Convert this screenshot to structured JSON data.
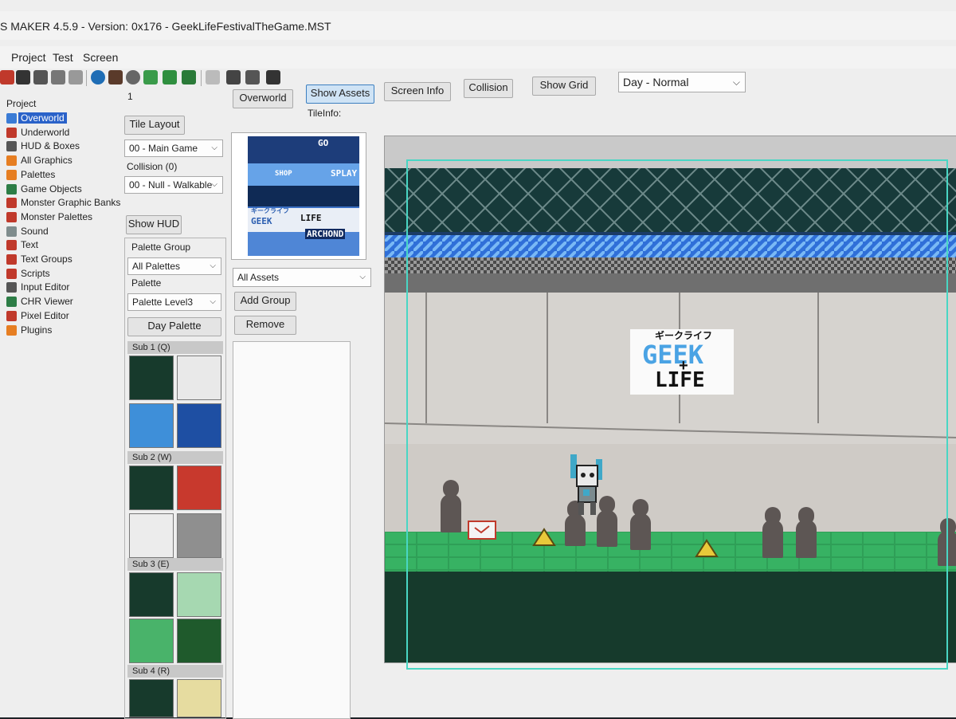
{
  "window": {
    "title": "S MAKER 4.5.9 - Version: 0x176 - GeekLifeFestivalTheGame.MST"
  },
  "menu": [
    "Project",
    "Test",
    "Screen"
  ],
  "tree": {
    "root": "Project",
    "items": [
      {
        "label": "Overworld",
        "selected": true,
        "icon_color": "#3a7bd5"
      },
      {
        "label": "Underworld",
        "icon_color": "#c0392b"
      },
      {
        "label": "HUD & Boxes",
        "icon_color": "#555555"
      },
      {
        "label": "All Graphics",
        "icon_color": "#e67e22"
      },
      {
        "label": "Palettes",
        "icon_color": "#e67e22"
      },
      {
        "label": "Game Objects",
        "icon_color": "#2d7d46"
      },
      {
        "label": "Monster Graphic Banks",
        "icon_color": "#c0392b"
      },
      {
        "label": "Monster Palettes",
        "icon_color": "#c0392b"
      },
      {
        "label": "Sound",
        "icon_color": "#7f8c8d"
      },
      {
        "label": "Text",
        "icon_color": "#c0392b"
      },
      {
        "label": "Text Groups",
        "icon_color": "#c0392b"
      },
      {
        "label": "Scripts",
        "icon_color": "#c0392b"
      },
      {
        "label": "Input Editor",
        "icon_color": "#555555"
      },
      {
        "label": "CHR Viewer",
        "icon_color": "#2d7d46"
      },
      {
        "label": "Pixel Editor",
        "icon_color": "#c0392b"
      },
      {
        "label": "Plugins",
        "icon_color": "#e67e22"
      }
    ]
  },
  "left_panel": {
    "index": "1",
    "tile_layout_button": "Tile Layout",
    "layer_select": "00 - Main Game",
    "collision_label": "Collision (0)",
    "collision_select": "00 - Null - Walkable",
    "show_hud_button": "Show HUD",
    "palette_group_label": "Palette Group",
    "palette_group_select": "All Palettes",
    "palette_label": "Palette",
    "palette_select": "Palette Level3",
    "day_palette_button": "Day Palette"
  },
  "palettes": [
    {
      "header": "Sub 1 (Q)",
      "colors": [
        "#173a2c",
        "#e9e9e9",
        "#3e8fd9",
        "#1e4fa3"
      ]
    },
    {
      "header": "Sub 2 (W)",
      "colors": [
        "#173a2c",
        "#c8392d",
        "#ececec",
        "#8f8f8f"
      ]
    },
    {
      "header": "Sub 3 (E)",
      "colors": [
        "#173a2c",
        "#a6d8b1",
        "#49b36a",
        "#1f5a2c"
      ]
    },
    {
      "header": "Sub 4 (R)",
      "colors": [
        "#173a2c",
        "#e6dca0"
      ]
    }
  ],
  "top_buttons": {
    "overworld": "Overworld",
    "show_assets": "Show Assets",
    "screen_info": "Screen Info",
    "collision": "Collision",
    "show_grid": "Show Grid",
    "time_select": "Day - Normal",
    "tileinfo_label": "TileInfo:"
  },
  "assets": {
    "filter_select": "All Assets",
    "add_group_button": "Add Group",
    "remove_button": "Remove"
  },
  "tileset_text": {
    "go": "GO",
    "shop": "SHOP",
    "splay": "SPLAY",
    "life": "LIFE",
    "geek": "GEEK",
    "archond": "ARCHOND",
    "small_jp": "ギークライフ"
  },
  "scene": {
    "sign_jp": "ギークライフ",
    "sign_geek": "GEEK",
    "sign_plus": "+",
    "sign_life": "LIFE"
  },
  "colors": {
    "accent_border": "#49d6c4",
    "floor_green": "#3fbf6a",
    "rail_blue": "#2f6fd8"
  }
}
